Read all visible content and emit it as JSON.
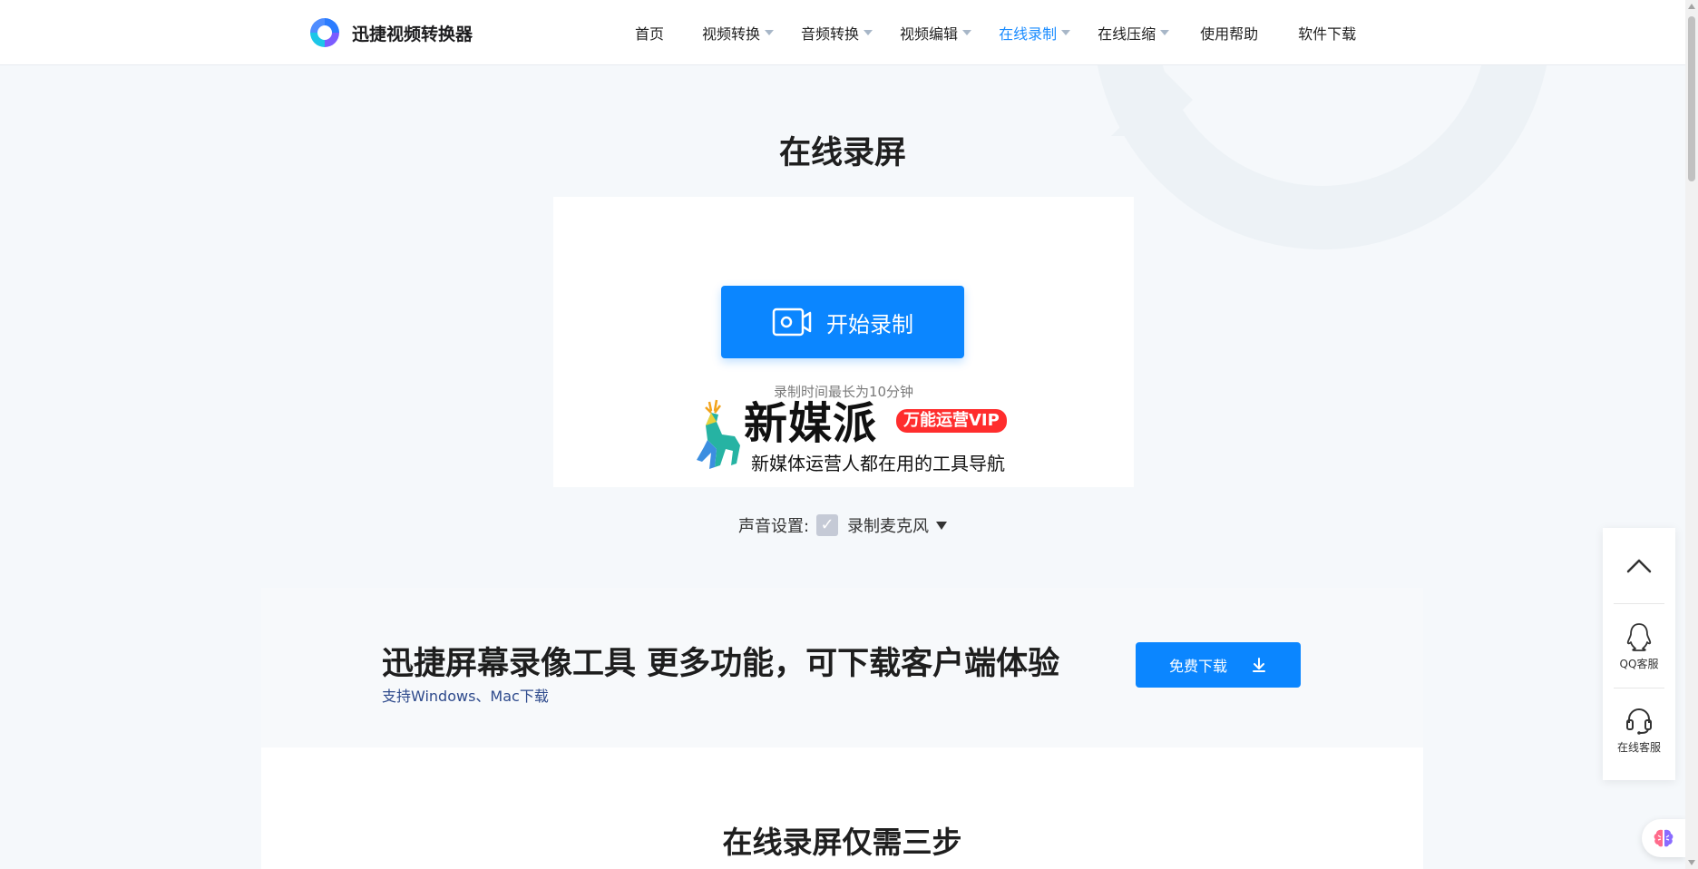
{
  "header": {
    "logo_text": "迅捷视频转换器",
    "nav": [
      {
        "label": "首页",
        "dropdown": false,
        "active": false
      },
      {
        "label": "视频转换",
        "dropdown": true,
        "active": false
      },
      {
        "label": "音频转换",
        "dropdown": true,
        "active": false
      },
      {
        "label": "视频编辑",
        "dropdown": true,
        "active": false
      },
      {
        "label": "在线录制",
        "dropdown": true,
        "active": true
      },
      {
        "label": "在线压缩",
        "dropdown": true,
        "active": false
      },
      {
        "label": "使用帮助",
        "dropdown": false,
        "active": false
      },
      {
        "label": "软件下载",
        "dropdown": false,
        "active": false
      }
    ]
  },
  "main": {
    "title": "在线录屏",
    "record_button_label": "开始录制",
    "record_note": "录制时间最长为10分钟",
    "ad": {
      "title": "新媒派",
      "badge": "万能运营VIP",
      "subtitle": "新媒体运营人都在用的工具导航"
    },
    "sound": {
      "label": "声音设置:",
      "checked": true,
      "option": "录制麦克风"
    }
  },
  "promo": {
    "title": "迅捷屏幕录像工具 更多功能，可下载客户端体验",
    "subtitle": "支持Windows、Mac下载",
    "download_label": "免费下载"
  },
  "steps": {
    "title": "在线录屏仅需三步"
  },
  "sidebar": {
    "qq_label": "QQ客服",
    "online_label": "在线客服"
  },
  "colors": {
    "accent": "#0b86ff",
    "nav_active": "#1a8cff",
    "badge": "#ff2d2d"
  },
  "icons": {
    "logo": "logo-icon",
    "record": "video-camera-icon",
    "download": "download-icon",
    "back_to_top": "chevron-up-icon",
    "qq": "qq-penguin-icon",
    "support": "headset-icon",
    "brain": "brain-icon"
  }
}
